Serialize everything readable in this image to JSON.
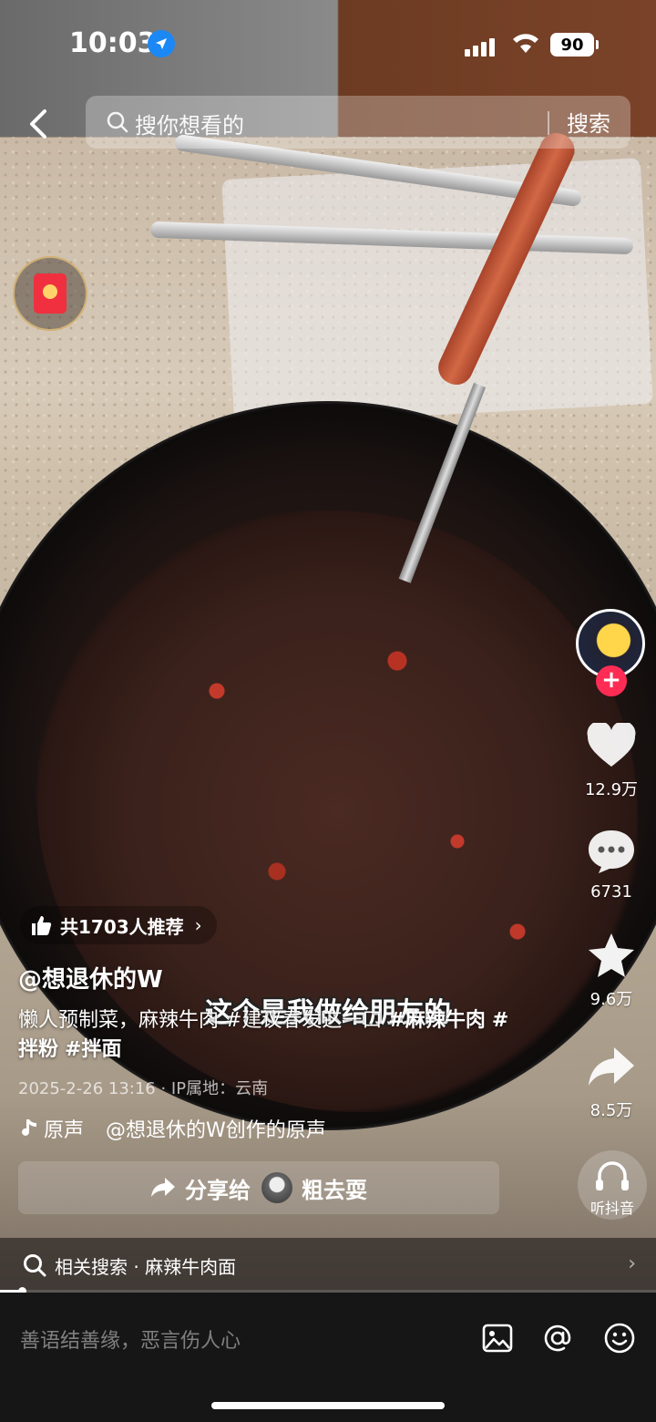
{
  "status_bar": {
    "time": "10:03",
    "battery": "90"
  },
  "search": {
    "placeholder": "搜你想看的",
    "button": "搜索"
  },
  "rail": {
    "likes": "12.9万",
    "comments": "6731",
    "favorites": "9.6万",
    "shares": "8.5万",
    "listen_label": "听抖音"
  },
  "video": {
    "recommend": "共1703人推荐",
    "author": "@想退休的W",
    "subtitle": "这个是我做给朋友的",
    "caption_text": "懒人预制菜，麻辣牛肉 #建议春发这一口 ",
    "caption_tags": [
      "#麻辣牛肉",
      "#拌粉",
      "#拌面"
    ],
    "meta": "2025-2-26 13:16 · IP属地：云南",
    "sound_label": "原声",
    "sound_owner": "@想退休的W创作的原声",
    "share_label": "分享给",
    "share_target": "粗去耍",
    "progress": 0.03
  },
  "related": {
    "text": "相关搜索 · 麻辣牛肉面"
  },
  "comment": {
    "placeholder": "善语结善缘，恶言伤人心"
  },
  "colors": {
    "follow": "#fe2c55",
    "location": "#1b88f5",
    "comment_bg": "#161616"
  }
}
